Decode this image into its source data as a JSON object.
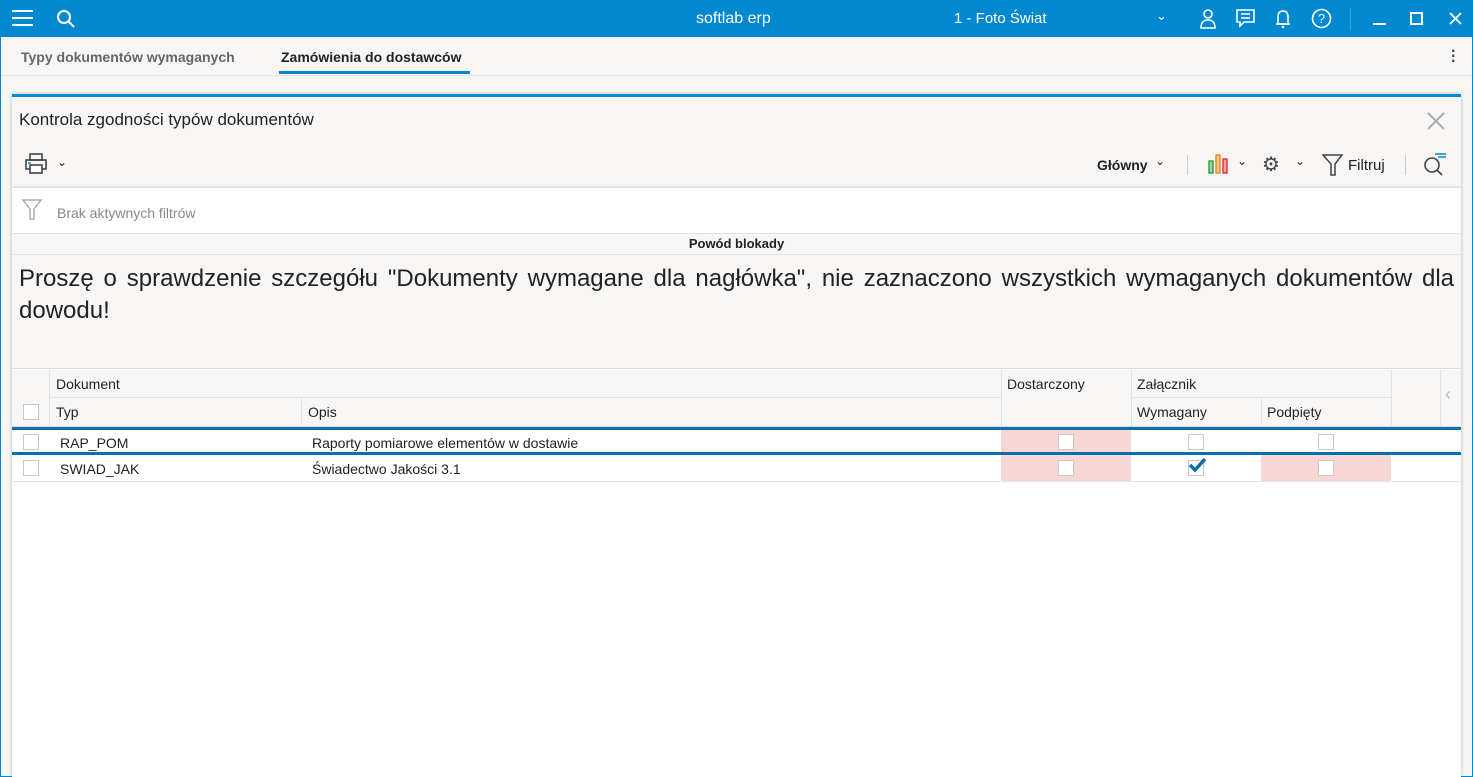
{
  "titlebar": {
    "app_name": "softlab erp",
    "company": "1 - Foto Świat"
  },
  "tabs": [
    {
      "label": "Typy dokumentów wymaganych"
    },
    {
      "label": "Zamówienia do dostawców",
      "active": true
    }
  ],
  "panel": {
    "title": "Kontrola zgodności typów dokumentów",
    "view_label": "Główny",
    "filter_label": "Filtruj",
    "no_filters": "Brak aktywnych filtrów"
  },
  "block_reason": {
    "header": "Powód blokady",
    "message": "Proszę o sprawdzenie szczegółu \"Dokumenty wymagane dla nagłówka\", nie zaznaczono wszystkich wymaganych dokumentów dla dowodu!"
  },
  "grid": {
    "group_document": "Dokument",
    "col_typ": "Typ",
    "col_opis": "Opis",
    "col_delivered": "Dostarczony",
    "group_attachment": "Załącznik",
    "col_required": "Wymagany",
    "col_attached": "Podpięty",
    "rows": [
      {
        "typ": "RAP_POM",
        "opis": "Raporty pomiarowe elementów w dostawie",
        "delivered": false,
        "required": false,
        "attached": false
      },
      {
        "typ": "SWIAD_JAK",
        "opis": "Świadectwo Jakości 3.1",
        "delivered": false,
        "required": true,
        "attached": false
      }
    ]
  },
  "colors": {
    "accent": "#0089d1",
    "warning_cell": "#f7d6d6"
  }
}
